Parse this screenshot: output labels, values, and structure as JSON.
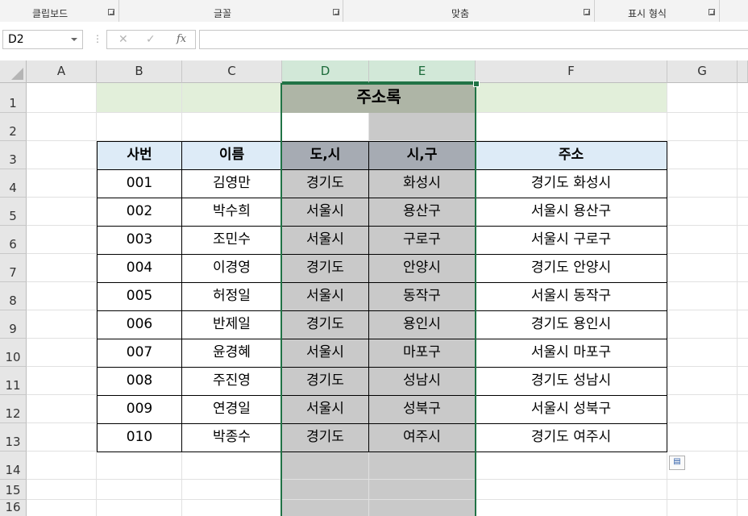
{
  "ribbon": {
    "groups": [
      {
        "label": "클립보드"
      },
      {
        "label": "글꼴"
      },
      {
        "label": "맞춤"
      },
      {
        "label": "표시 형식"
      }
    ]
  },
  "formula_bar": {
    "name_box": "D2",
    "cancel_icon": "✕",
    "enter_icon": "✓",
    "fx_label": "fx",
    "formula": ""
  },
  "columns": [
    "A",
    "B",
    "C",
    "D",
    "E",
    "F",
    "G"
  ],
  "rows": [
    "1",
    "2",
    "3",
    "4",
    "5",
    "6",
    "7",
    "8",
    "9",
    "10",
    "11",
    "12",
    "13",
    "14",
    "15",
    "16"
  ],
  "sheet": {
    "title": "주소록",
    "headers": [
      "사번",
      "이름",
      "도,시",
      "시,구",
      "주소"
    ],
    "records": [
      [
        "001",
        "김영만",
        "경기도",
        "화성시",
        "경기도 화성시"
      ],
      [
        "002",
        "박수희",
        "서울시",
        "용산구",
        "서울시 용산구"
      ],
      [
        "003",
        "조민수",
        "서울시",
        "구로구",
        "서울시 구로구"
      ],
      [
        "004",
        "이경영",
        "경기도",
        "안양시",
        "경기도 안양시"
      ],
      [
        "005",
        "허정일",
        "서울시",
        "동작구",
        "서울시 동작구"
      ],
      [
        "006",
        "반제일",
        "경기도",
        "용인시",
        "경기도 용인시"
      ],
      [
        "007",
        "윤경혜",
        "서울시",
        "마포구",
        "서울시 마포구"
      ],
      [
        "008",
        "주진영",
        "경기도",
        "성남시",
        "경기도 성남시"
      ],
      [
        "009",
        "연경일",
        "서울시",
        "성북구",
        "서울시 성북구"
      ],
      [
        "010",
        "박종수",
        "경기도",
        "여주시",
        "경기도 여주시"
      ]
    ]
  },
  "colors": {
    "selection": "#217346",
    "banner": "#e2efda",
    "title_fill": "#aeb5a6",
    "header_fill": "#ddebf7",
    "gray_fill": "#c9c9c9"
  },
  "icons": {
    "paste_options": "paste-options-icon"
  }
}
